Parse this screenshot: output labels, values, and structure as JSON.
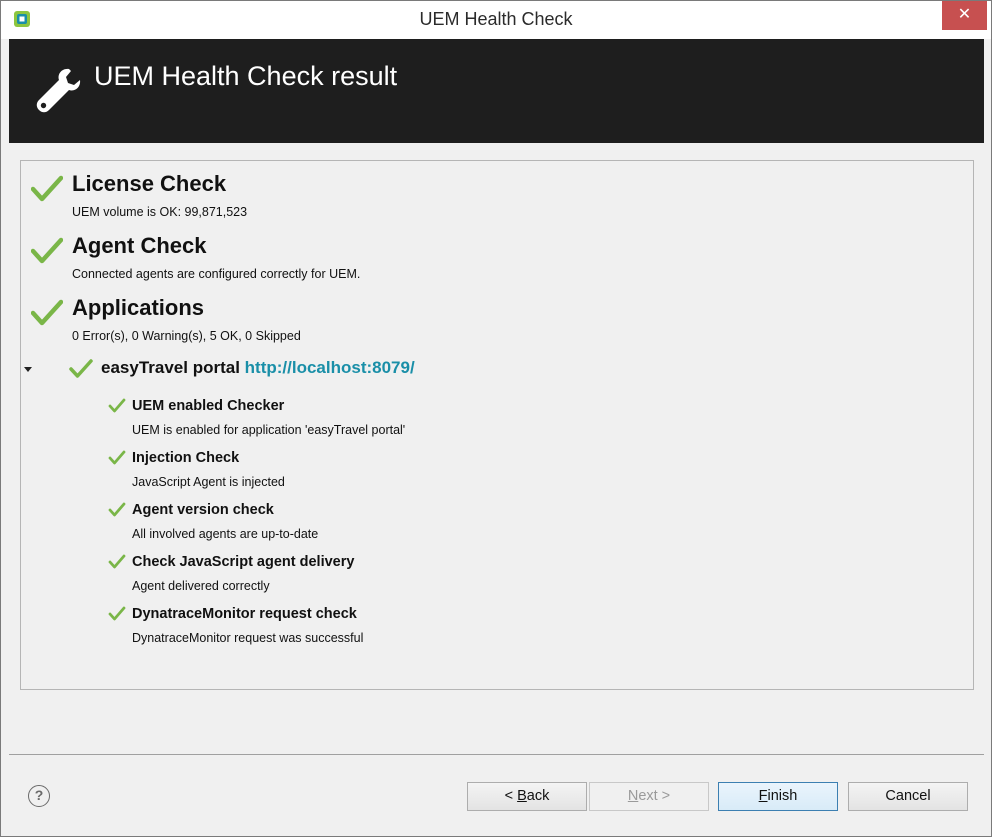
{
  "window": {
    "title": "UEM Health Check",
    "close_label": "✕"
  },
  "banner": {
    "title": "UEM Health Check result"
  },
  "checks": [
    {
      "title": "License Check",
      "desc": "UEM volume is OK: 99,871,523"
    },
    {
      "title": "Agent Check",
      "desc": "Connected agents are configured correctly for UEM."
    },
    {
      "title": "Applications",
      "desc": "0 Error(s), 0 Warning(s), 5 OK, 0 Skipped"
    }
  ],
  "application": {
    "name": "easyTravel portal",
    "url": "http://localhost:8079/",
    "subchecks": [
      {
        "title": "UEM enabled Checker",
        "desc": "UEM is enabled for application 'easyTravel portal'"
      },
      {
        "title": "Injection Check",
        "desc": "JavaScript Agent is injected"
      },
      {
        "title": "Agent version check",
        "desc": "All involved agents are up-to-date"
      },
      {
        "title": "Check JavaScript agent delivery",
        "desc": "Agent delivered correctly"
      },
      {
        "title": "DynatraceMonitor request check",
        "desc": "DynatraceMonitor request was successful"
      }
    ]
  },
  "footer": {
    "help": "?",
    "back_prefix": "< ",
    "back_mnemonic": "B",
    "back_rest": "ack",
    "next_mnemonic": "N",
    "next_rest": "ext >",
    "finish_mnemonic": "F",
    "finish_rest": "inish",
    "cancel": "Cancel"
  },
  "colors": {
    "check_green": "#7ab648",
    "banner_bg": "#1e1e1e",
    "link": "#1a8fa8",
    "close_red": "#c75050"
  }
}
